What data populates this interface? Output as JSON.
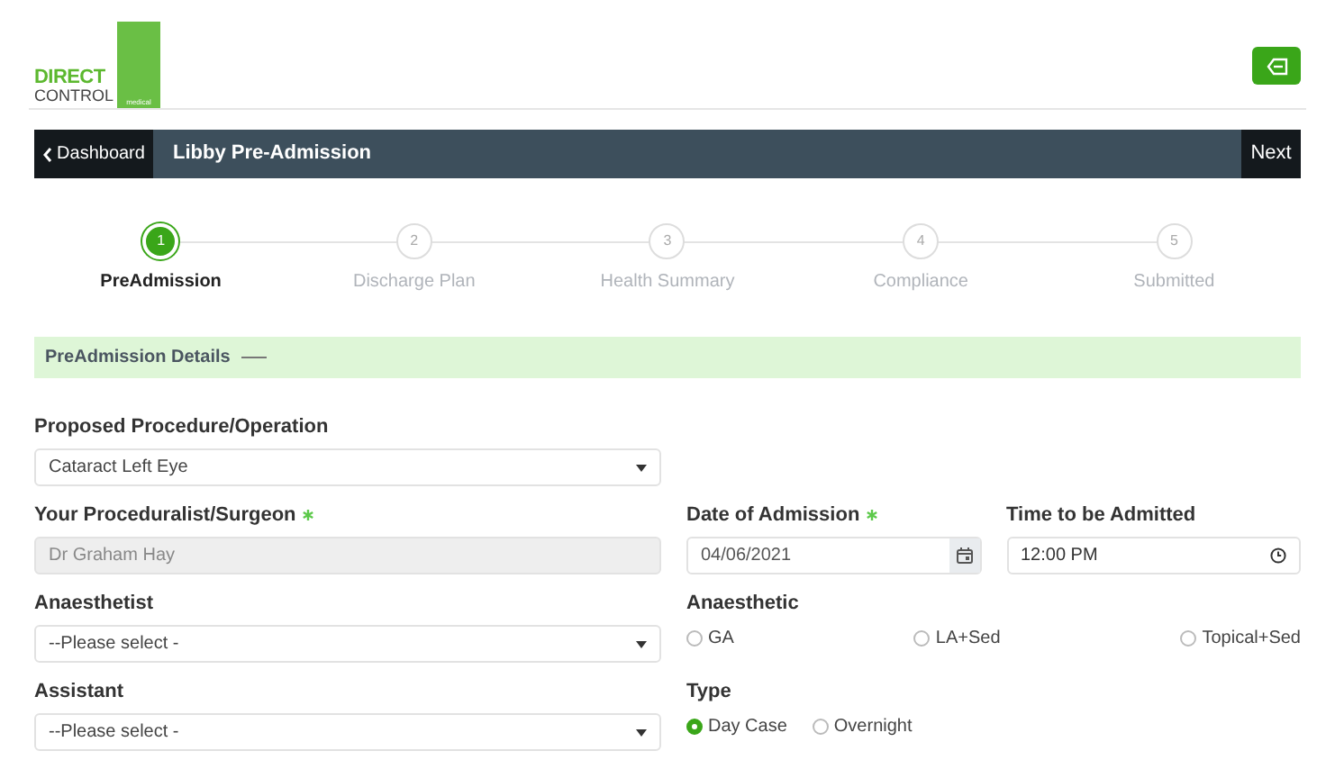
{
  "logo": {
    "line1": "DIRECT",
    "line2": "CONTROL",
    "tag": "medical"
  },
  "nav": {
    "back": "Dashboard",
    "title": "Libby Pre-Admission",
    "next": "Next"
  },
  "steps": [
    {
      "number": "1",
      "label": "PreAdmission",
      "selected": true
    },
    {
      "number": "2",
      "label": "Discharge Plan",
      "selected": false
    },
    {
      "number": "3",
      "label": "Health Summary",
      "selected": false
    },
    {
      "number": "4",
      "label": "Compliance",
      "selected": false
    },
    {
      "number": "5",
      "label": "Submitted",
      "selected": false
    }
  ],
  "section": {
    "title": "PreAdmission Details"
  },
  "rows": [
    {
      "left": {
        "kind": "select",
        "label": "Proposed Procedure/Operation",
        "required": false,
        "value": "Cataract Left Eye"
      },
      "right": []
    },
    {
      "left": {
        "kind": "text",
        "label": "Your Proceduralist/Surgeon",
        "required": true,
        "disabled": true,
        "value": "Dr Graham Hay"
      },
      "right": [
        {
          "kind": "date",
          "label": "Date of Admission",
          "required": true,
          "value": "04/06/2021"
        },
        {
          "kind": "time",
          "label": "Time to be Admitted",
          "required": false,
          "value": "12:00 PM"
        }
      ]
    },
    {
      "left": {
        "kind": "select",
        "label": "Anaesthetist",
        "required": false,
        "value": "--Please select -"
      },
      "right": [
        {
          "kind": "radios",
          "spread": true,
          "label": "Anaesthetic",
          "required": false,
          "options": [
            {
              "label": "GA",
              "selected": false
            },
            {
              "label": "LA+Sed",
              "selected": false
            },
            {
              "label": "Topical+Sed",
              "selected": false
            }
          ]
        }
      ]
    },
    {
      "left": {
        "kind": "select",
        "label": "Assistant",
        "required": false,
        "value": "--Please select -"
      },
      "right": [
        {
          "kind": "radios",
          "spread": false,
          "label": "Type",
          "required": false,
          "options": [
            {
              "label": "Day Case",
              "selected": true
            },
            {
              "label": "Overnight",
              "selected": false
            }
          ]
        }
      ]
    }
  ]
}
